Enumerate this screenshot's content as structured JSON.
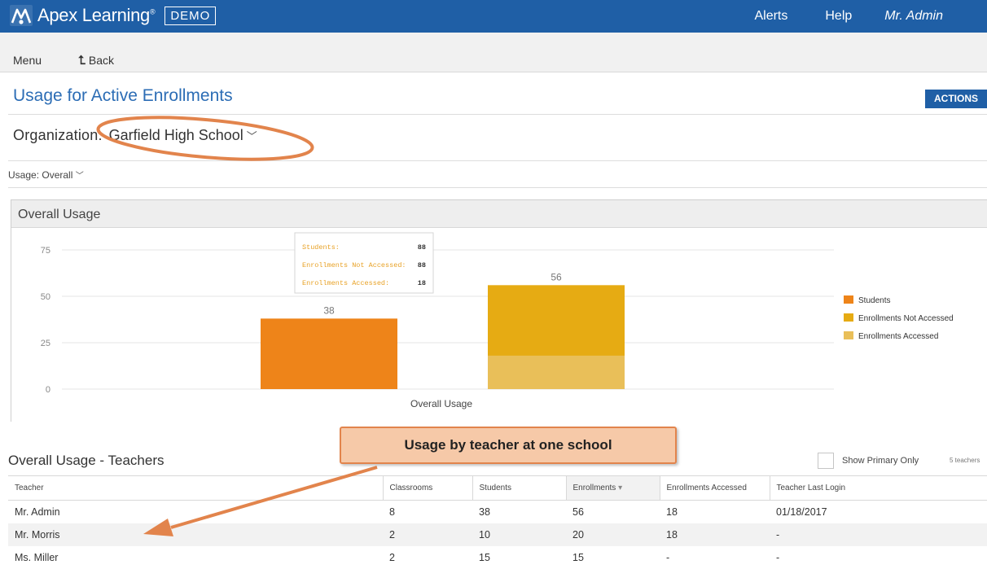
{
  "header": {
    "brand": "Apex Learning",
    "trademark": "®",
    "badge": "DEMO",
    "nav": [
      "Alerts",
      "Help",
      "Mr. Admin"
    ]
  },
  "subnav": {
    "menu": "Menu",
    "back": "Back"
  },
  "page": {
    "title": "Usage for Active Enrollments",
    "actions_label": "ACTIONS",
    "org_label": "Organization:",
    "org_value": "Garfield High School",
    "usage_label": "Usage: Overall"
  },
  "chart_panel": {
    "title": "Overall Usage"
  },
  "chart_data": {
    "type": "bar",
    "categories": [
      "Overall Usage"
    ],
    "x_label": "Overall Usage",
    "y_ticks": [
      0,
      25,
      50,
      75
    ],
    "ylim": [
      0,
      80
    ],
    "series": [
      {
        "name": "Students",
        "values": [
          38
        ],
        "color": "#ee8419",
        "stack": "a"
      },
      {
        "name": "Enrollments Not Accessed",
        "values": [
          38
        ],
        "color": "#e6ab13",
        "stack": "b"
      },
      {
        "name": "Enrollments Accessed",
        "values": [
          18
        ],
        "color": "#e9bf59",
        "stack": "b"
      }
    ],
    "data_labels": [
      "38",
      "56"
    ],
    "legend_position": "right",
    "tooltip": [
      {
        "label": "Students:",
        "value": "88"
      },
      {
        "label": "Enrollments Not Accessed:",
        "value": "88"
      },
      {
        "label": "Enrollments Accessed:",
        "value": "18"
      }
    ]
  },
  "teachers": {
    "title": "Overall Usage - Teachers",
    "show_primary_label": "Show Primary Only",
    "count_label": "5 teachers",
    "columns": [
      "Teacher",
      "Classrooms",
      "Students",
      "Enrollments",
      "Enrollments Accessed",
      "Teacher Last Login"
    ],
    "rows": [
      [
        "Mr. Admin",
        "8",
        "38",
        "56",
        "18",
        "01/18/2017"
      ],
      [
        "Mr. Morris",
        "2",
        "10",
        "20",
        "18",
        "-"
      ],
      [
        "Ms. Miller",
        "2",
        "15",
        "15",
        "-",
        "-"
      ]
    ]
  },
  "annotation": {
    "callout": "Usage by teacher at one school"
  },
  "colors": {
    "brand_blue": "#1f5fa6",
    "link_blue": "#2c6db5",
    "annotation_orange": "#e2844c"
  }
}
